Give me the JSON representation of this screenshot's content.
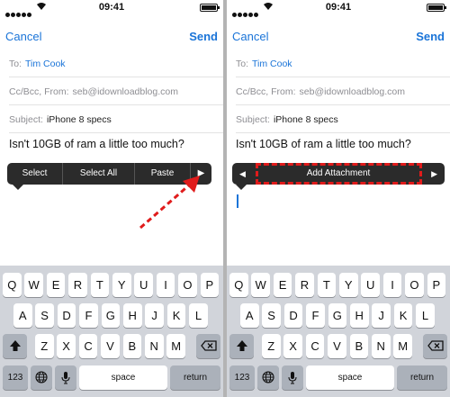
{
  "status": {
    "time": "09:41"
  },
  "compose": {
    "cancel_label": "Cancel",
    "send_label": "Send",
    "to_label": "To:",
    "to_value": "Tim Cook",
    "cc_label": "Cc/Bcc, From:",
    "cc_value": "seb@idownloadblog.com",
    "subject_label": "Subject:",
    "subject_value": "iPhone 8 specs",
    "body": "Isn't 10GB of ram a little too much?"
  },
  "edit_menu_left": {
    "items": [
      "Select",
      "Select All",
      "Paste"
    ],
    "more_arrow": "▶"
  },
  "edit_menu_right": {
    "prev_arrow": "◀",
    "item": "Add Attachment",
    "next_arrow": "▶"
  },
  "annotation_color": "#e01b1b",
  "keyboard": {
    "row1": [
      "Q",
      "W",
      "E",
      "R",
      "T",
      "Y",
      "U",
      "I",
      "O",
      "P"
    ],
    "row2": [
      "A",
      "S",
      "D",
      "F",
      "G",
      "H",
      "J",
      "K",
      "L"
    ],
    "row3": [
      "Z",
      "X",
      "C",
      "V",
      "B",
      "N",
      "M"
    ],
    "shift_icon": "shift-arrow",
    "delete_icon": "backspace",
    "numbers_label": "123",
    "globe_icon": "globe",
    "mic_icon": "microphone",
    "space_label": "space",
    "return_label": "return"
  }
}
